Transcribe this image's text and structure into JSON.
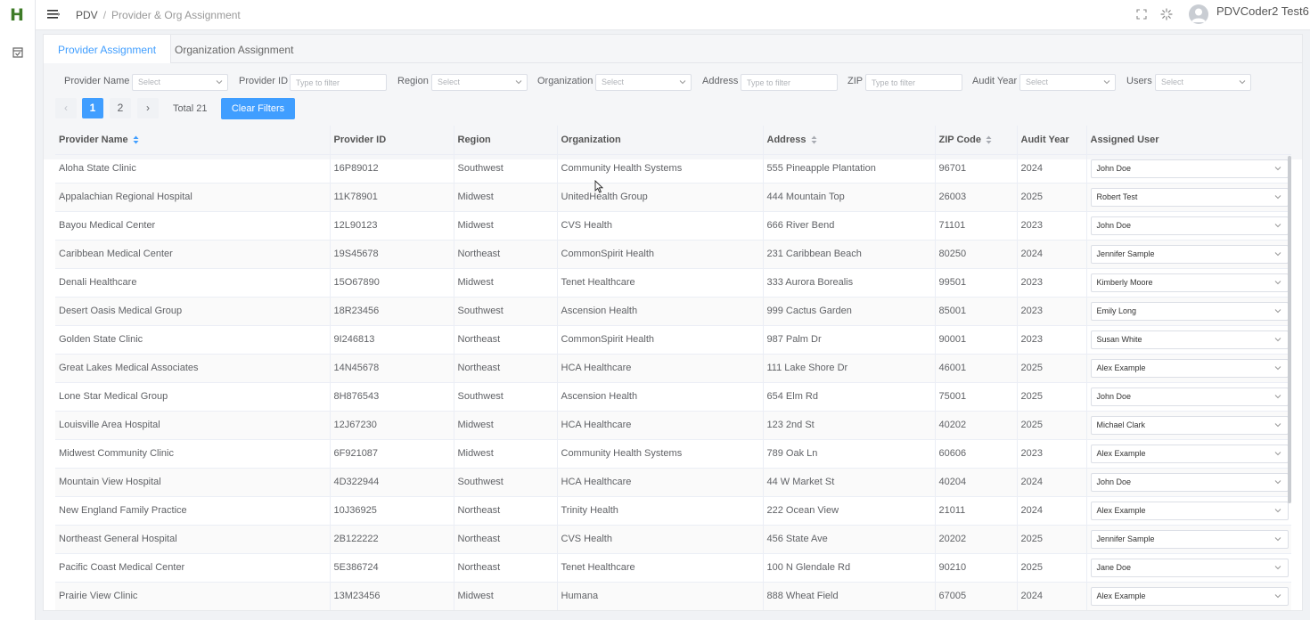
{
  "app": {
    "logo_letter": "H"
  },
  "header": {
    "breadcrumb_root": "PDV",
    "breadcrumb_sep": "/",
    "breadcrumb_current": "Provider & Org Assignment",
    "user_name": "PDVCoder2 Test6"
  },
  "tabs": [
    {
      "label": "Provider Assignment",
      "active": true
    },
    {
      "label": "Organization Assignment",
      "active": false
    }
  ],
  "filters": {
    "provider_name": {
      "label": "Provider Name",
      "placeholder": "Select"
    },
    "provider_id": {
      "label": "Provider ID",
      "placeholder": "Type to filter"
    },
    "region": {
      "label": "Region",
      "placeholder": "Select"
    },
    "organization": {
      "label": "Organization",
      "placeholder": "Select"
    },
    "address": {
      "label": "Address",
      "placeholder": "Type to filter"
    },
    "zip": {
      "label": "ZIP",
      "placeholder": "Type to filter"
    },
    "audit_year": {
      "label": "Audit Year",
      "placeholder": "Select"
    },
    "users": {
      "label": "Users",
      "placeholder": "Select"
    }
  },
  "pagination": {
    "prev": "‹",
    "pages": [
      "1",
      "2"
    ],
    "current_page": "1",
    "next": "›",
    "total_label": "Total 21"
  },
  "clear_filters_label": "Clear Filters",
  "table": {
    "columns": [
      {
        "label": "Provider Name",
        "sortable": true
      },
      {
        "label": "Provider ID",
        "sortable": false
      },
      {
        "label": "Region",
        "sortable": false
      },
      {
        "label": "Organization",
        "sortable": false
      },
      {
        "label": "Address",
        "sortable": true
      },
      {
        "label": "ZIP Code",
        "sortable": true
      },
      {
        "label": "Audit Year",
        "sortable": false
      },
      {
        "label": "Assigned User",
        "sortable": false
      }
    ],
    "rows": [
      [
        "Aloha State Clinic",
        "16P89012",
        "Southwest",
        "Community Health Systems",
        "555 Pineapple Plantation",
        "96701",
        "2024",
        "John Doe"
      ],
      [
        "Appalachian Regional Hospital",
        "11K78901",
        "Midwest",
        "UnitedHealth Group",
        "444 Mountain Top",
        "26003",
        "2025",
        "Robert Test"
      ],
      [
        "Bayou Medical Center",
        "12L90123",
        "Midwest",
        "CVS Health",
        "666 River Bend",
        "71101",
        "2023",
        "John Doe"
      ],
      [
        "Caribbean Medical Center",
        "19S45678",
        "Northeast",
        "CommonSpirit Health",
        "231 Caribbean Beach",
        "80250",
        "2024",
        "Jennifer Sample"
      ],
      [
        "Denali Healthcare",
        "15O67890",
        "Midwest",
        "Tenet Healthcare",
        "333 Aurora Borealis",
        "99501",
        "2023",
        "Kimberly Moore"
      ],
      [
        "Desert Oasis Medical Group",
        "18R23456",
        "Southwest",
        "Ascension Health",
        "999 Cactus Garden",
        "85001",
        "2023",
        "Emily Long"
      ],
      [
        "Golden State Clinic",
        "9I246813",
        "Northeast",
        "CommonSpirit Health",
        "987 Palm Dr",
        "90001",
        "2023",
        "Susan White"
      ],
      [
        "Great Lakes Medical Associates",
        "14N45678",
        "Northeast",
        "HCA Healthcare",
        "111 Lake Shore Dr",
        "46001",
        "2025",
        "Alex Example"
      ],
      [
        "Lone Star Medical Group",
        "8H876543",
        "Southwest",
        "Ascension Health",
        "654 Elm Rd",
        "75001",
        "2025",
        "John Doe"
      ],
      [
        "Louisville Area Hospital",
        "12J67230",
        "Midwest",
        "HCA Healthcare",
        "123 2nd St",
        "40202",
        "2025",
        "Michael Clark"
      ],
      [
        "Midwest Community Clinic",
        "6F921087",
        "Midwest",
        "Community Health Systems",
        "789 Oak Ln",
        "60606",
        "2023",
        "Alex Example"
      ],
      [
        "Mountain View Hospital",
        "4D322944",
        "Southwest",
        "HCA Healthcare",
        "44 W Market St",
        "40204",
        "2024",
        "John Doe"
      ],
      [
        "New England Family Practice",
        "10J36925",
        "Northeast",
        "Trinity Health",
        "222 Ocean View",
        "21011",
        "2024",
        "Alex Example"
      ],
      [
        "Northeast General Hospital",
        "2B122222",
        "Northeast",
        "CVS Health",
        "456 State Ave",
        "20202",
        "2025",
        "Jennifer Sample"
      ],
      [
        "Pacific Coast Medical Center",
        "5E386724",
        "Northeast",
        "Tenet Healthcare",
        "100 N Glendale Rd",
        "90210",
        "2025",
        "Jane Doe"
      ],
      [
        "Prairie View Clinic",
        "13M23456",
        "Midwest",
        "Humana",
        "888 Wheat Field",
        "67005",
        "2024",
        "Alex Example"
      ]
    ]
  },
  "icons": {
    "logo": "logo-h-icon",
    "rail": "inbox-check-icon",
    "menu": "menu-fold-icon",
    "fullscreen": "fullscreen-icon",
    "loading": "spinner-icon",
    "avatar": "user-avatar-icon"
  },
  "colors": {
    "primary": "#409eff",
    "logo_green": "#3e7b27"
  }
}
